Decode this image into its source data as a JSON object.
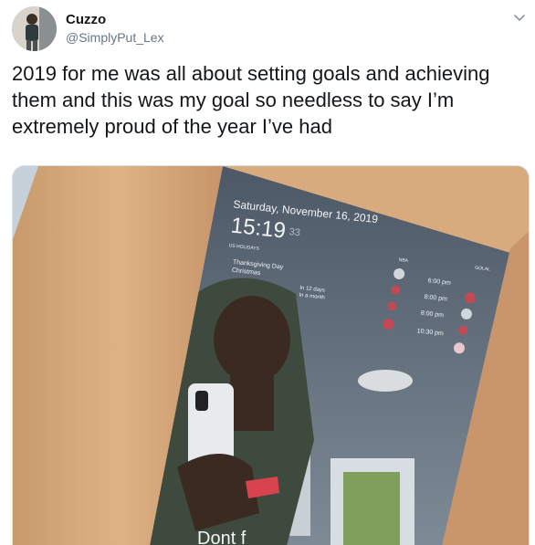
{
  "author": {
    "display_name": "Cuzzo",
    "handle": "@SimplyPut_Lex"
  },
  "tweet": {
    "text": "2019 for me was all about setting goals and achieving them and this was my goal so needless to say I’m extremely proud of the year I’ve had"
  },
  "icons": {
    "menu_caret": "chevron-down-icon"
  },
  "mirror_display": {
    "date": "Saturday, November 16, 2019",
    "time": "15:19",
    "seconds": "33",
    "section_label": "US HOLIDAYS",
    "holidays": [
      {
        "name": "Thanksgiving Day",
        "when": "In 12 days"
      },
      {
        "name": "Christmas",
        "when": "In a month"
      }
    ],
    "games_header_left": "NBA",
    "games_header_right": "GOLAL",
    "game_times": [
      "6:00 pm",
      "8:00 pm",
      "8:00 pm",
      "10:30 pm"
    ],
    "bottom_text": "Dont f"
  }
}
